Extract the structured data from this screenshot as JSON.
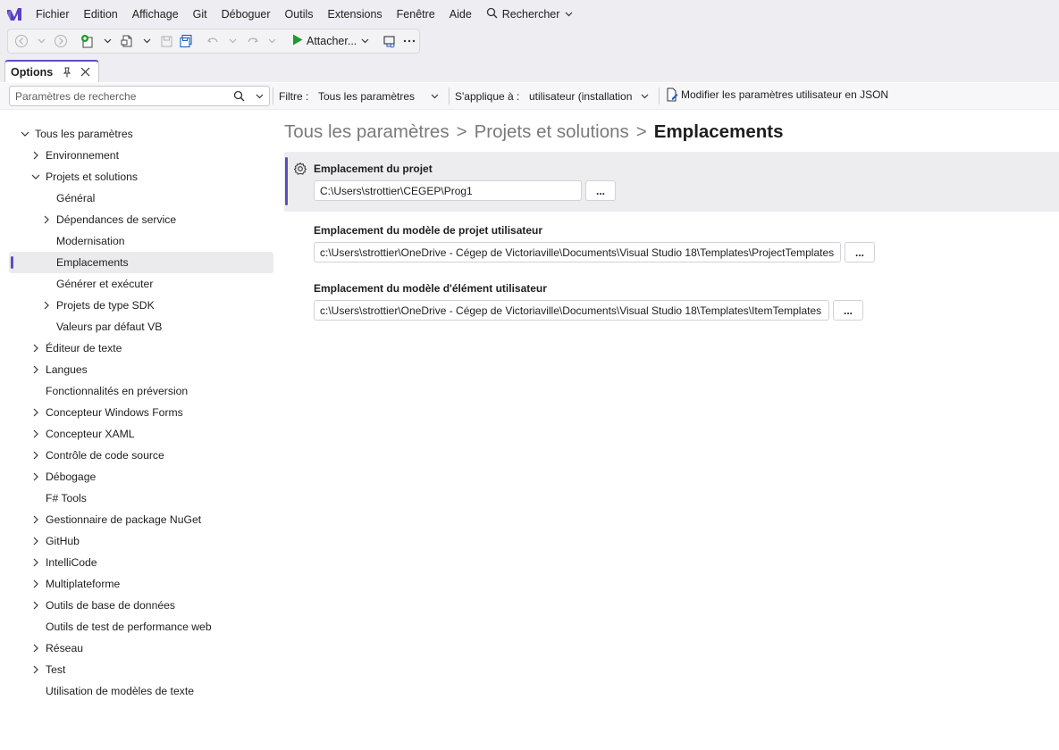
{
  "menubar": {
    "logo": "visual-studio-logo",
    "items": [
      {
        "label": "Fichier"
      },
      {
        "label": "Edition"
      },
      {
        "label": "Affichage"
      },
      {
        "label": "Git"
      },
      {
        "label": "Déboguer"
      },
      {
        "label": "Outils"
      },
      {
        "label": "Extensions"
      },
      {
        "label": "Fenêtre"
      },
      {
        "label": "Aide"
      }
    ],
    "search_label": "Rechercher"
  },
  "toolbar": {
    "attach_label": "Attacher...",
    "accent": "#1e9b2e"
  },
  "tab": {
    "title": "Options"
  },
  "filterbar": {
    "search_placeholder": "Paramètres de recherche",
    "filter_label": "Filtre :",
    "filter_value": "Tous les paramètres",
    "applies_label": "S'applique à :",
    "applies_value": "utilisateur (installation",
    "json_link": "Modifier les paramètres utilisateur en JSON"
  },
  "tree": {
    "items": [
      {
        "label": "Tous les paramètres",
        "level": 0,
        "chevron": "down"
      },
      {
        "label": "Environnement",
        "level": 1,
        "chevron": "right"
      },
      {
        "label": "Projets et solutions",
        "level": 1,
        "chevron": "down"
      },
      {
        "label": "Général",
        "level": 2,
        "chevron": "none"
      },
      {
        "label": "Dépendances de service",
        "level": 2,
        "chevron": "right"
      },
      {
        "label": "Modernisation",
        "level": 2,
        "chevron": "none"
      },
      {
        "label": "Emplacements",
        "level": 2,
        "chevron": "none",
        "selected": true
      },
      {
        "label": "Générer et exécuter",
        "level": 2,
        "chevron": "none"
      },
      {
        "label": "Projets de type SDK",
        "level": 2,
        "chevron": "right"
      },
      {
        "label": "Valeurs par défaut VB",
        "level": 2,
        "chevron": "none"
      },
      {
        "label": "Éditeur de texte",
        "level": 1,
        "chevron": "right"
      },
      {
        "label": "Langues",
        "level": 1,
        "chevron": "right"
      },
      {
        "label": "Fonctionnalités en préversion",
        "level": 1,
        "chevron": "none"
      },
      {
        "label": "Concepteur Windows Forms",
        "level": 1,
        "chevron": "right"
      },
      {
        "label": "Concepteur XAML",
        "level": 1,
        "chevron": "right"
      },
      {
        "label": "Contrôle de code source",
        "level": 1,
        "chevron": "right"
      },
      {
        "label": "Débogage",
        "level": 1,
        "chevron": "right"
      },
      {
        "label": "F# Tools",
        "level": 1,
        "chevron": "none"
      },
      {
        "label": "Gestionnaire de package NuGet",
        "level": 1,
        "chevron": "right"
      },
      {
        "label": "GitHub",
        "level": 1,
        "chevron": "right"
      },
      {
        "label": "IntelliCode",
        "level": 1,
        "chevron": "right"
      },
      {
        "label": "Multiplateforme",
        "level": 1,
        "chevron": "right"
      },
      {
        "label": "Outils de base de données",
        "level": 1,
        "chevron": "right"
      },
      {
        "label": "Outils de test de performance web",
        "level": 1,
        "chevron": "none"
      },
      {
        "label": "Réseau",
        "level": 1,
        "chevron": "right"
      },
      {
        "label": "Test",
        "level": 1,
        "chevron": "right"
      },
      {
        "label": "Utilisation de modèles de texte",
        "level": 1,
        "chevron": "none"
      }
    ]
  },
  "breadcrumb": {
    "root": "Tous les paramètres",
    "sep1": ">",
    "section": "Projets et solutions",
    "sep2": ">",
    "current": "Emplacements"
  },
  "settings": [
    {
      "title": "Emplacement du projet",
      "value": "C:\\Users\\strottier\\CEGEP\\Prog1",
      "button": "..."
    },
    {
      "title": "Emplacement du modèle de projet utilisateur",
      "value": "c:\\Users\\strottier\\OneDrive - Cégep de Victoriaville\\Documents\\Visual Studio 18\\Templates\\ProjectTemplates",
      "button": "..."
    },
    {
      "title": "Emplacement du modèle d'élément utilisateur",
      "value": "c:\\Users\\strottier\\OneDrive - Cégep de Victoriaville\\Documents\\Visual Studio 18\\Templates\\ItemTemplates",
      "button": "..."
    }
  ]
}
